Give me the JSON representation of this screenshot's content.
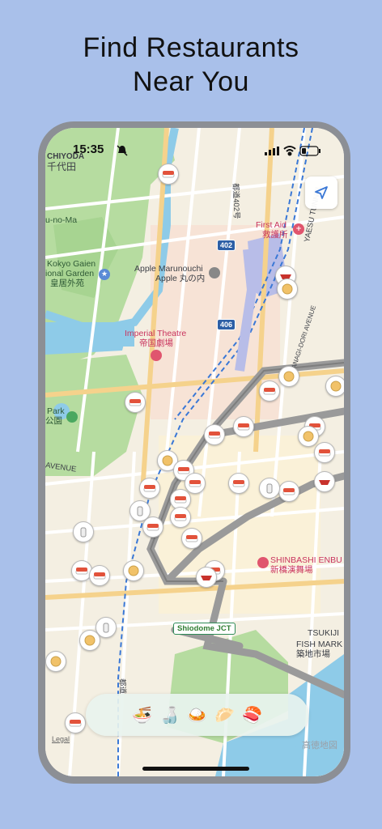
{
  "headline": {
    "line1": "Find Restaurants",
    "line2": "Near You"
  },
  "status_bar": {
    "time": "15:35"
  },
  "map": {
    "labels": {
      "chiyoda_en": "CHIYODA",
      "chiyoda_jp": "千代田",
      "nomaru": "u-no-Ma",
      "kokyo_en1": "Kokyo Gaien",
      "kokyo_en2": "ional Garden",
      "kokyo_jp": "皇居外苑",
      "apple_en": "Apple Marunouchi",
      "apple_jp": "Apple 丸の内",
      "first_aid_en": "First Aid",
      "first_aid_jp": "救護所",
      "yaesu": "YAESU TUNNEL",
      "yanagi": "YANAGI-DORI AVENUE",
      "theatre_en": "Imperial Theatre",
      "theatre_jp": "帝国劇場",
      "park_en": "Park",
      "park_jp": "公園",
      "avenue": "AVENUE",
      "shinbashi_en": "SHINBASHI ENBU",
      "shinbashi_jp": "新橋演舞場",
      "tsukiji1": "TSUKIJI",
      "tsukiji2": "FISH MARK",
      "tsukiji_jp": "築地市場",
      "route_vertical": "都道402号",
      "route_vertical2": "都道"
    },
    "route_shields": [
      "402",
      "406"
    ],
    "junction": "Shiodome JCT",
    "legal": "Legal",
    "brand": "高徳地図"
  },
  "category_bar": {
    "items": [
      {
        "name": "ramen",
        "glyph": "🍜"
      },
      {
        "name": "sake",
        "glyph": "🍶"
      },
      {
        "name": "curry",
        "glyph": "🍛"
      },
      {
        "name": "gyoza",
        "glyph": "🥟"
      },
      {
        "name": "sushi",
        "glyph": "🍣"
      }
    ]
  },
  "colors": {
    "background": "#a9c0ea",
    "phone_frame": "#8c8f95",
    "map_base": "#f4efe2",
    "park": "#b6dca0",
    "water": "#8ecbe8",
    "highway": "#9a9a9a",
    "rail": "#3a78d6"
  }
}
